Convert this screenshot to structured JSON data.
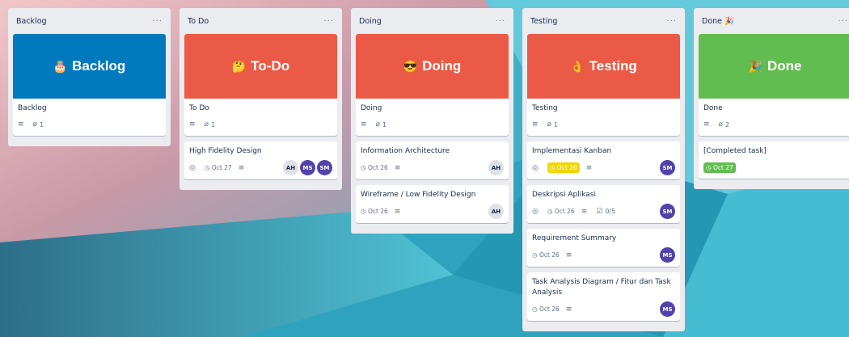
{
  "colors": {
    "board_bg": "#3fb0c8",
    "list_bg": "#ebecf0",
    "cover_blue": "#0079bf",
    "cover_red": "#eb5a46",
    "cover_green": "#61bd4f",
    "due_yellow": "#f2d600",
    "due_green": "#61bd4f",
    "avatar_purple": "#5243aa"
  },
  "lists": [
    {
      "title": "Backlog",
      "menu": "···",
      "cover": {
        "emoji": "🎂",
        "text": "Backlog",
        "color": "#0079bf"
      },
      "cover_card": {
        "title": "Backlog",
        "attachments": "1"
      },
      "cards": []
    },
    {
      "title": "To Do",
      "menu": "···",
      "cover": {
        "emoji": "🤔",
        "text": "To-Do",
        "color": "#eb5a46"
      },
      "cover_card": {
        "title": "To Do",
        "attachments": "1"
      },
      "cards": [
        {
          "title": "High Fidelity Design",
          "due": "Oct 27",
          "avatars": [
            "AH",
            "MS",
            "SM"
          ]
        }
      ]
    },
    {
      "title": "Doing",
      "menu": "···",
      "cover": {
        "emoji": "😎",
        "text": "Doing",
        "color": "#eb5a46"
      },
      "cover_card": {
        "title": "Doing",
        "attachments": "1"
      },
      "cards": [
        {
          "title": "Information Architecture",
          "due": "Oct 26",
          "avatars": [
            "AH"
          ]
        },
        {
          "title": "Wireframe / Low Fidelity Design",
          "due": "Oct 26",
          "avatars": [
            "AH"
          ]
        }
      ]
    },
    {
      "title": "Testing",
      "menu": "···",
      "cover": {
        "emoji": "👌",
        "text": "Testing",
        "color": "#eb5a46"
      },
      "cover_card": {
        "title": "Testing",
        "attachments": "1"
      },
      "cards": [
        {
          "title": "Implementasi Kanban",
          "due": "Oct 26",
          "avatars": [
            "SM"
          ]
        },
        {
          "title": "Deskripsi Aplikasi",
          "due": "Oct 26",
          "checklist": "0/5",
          "avatars": [
            "SM"
          ]
        },
        {
          "title": "Requirement Summary",
          "due": "Oct 26",
          "avatars": [
            "MS"
          ]
        },
        {
          "title": "Task Analysis Diagram / Fitur dan Task Analysis",
          "due": "Oct 26",
          "avatars": [
            "MS"
          ]
        }
      ]
    },
    {
      "title": "Done 🎉",
      "menu": "···",
      "cover": {
        "emoji": "🎉",
        "text": "Done",
        "color": "#61bd4f"
      },
      "cover_card": {
        "title": "Done",
        "attachments": "2"
      },
      "cards": [
        {
          "title": "[Completed task]",
          "due": "Oct 27",
          "avatars": []
        }
      ]
    }
  ]
}
